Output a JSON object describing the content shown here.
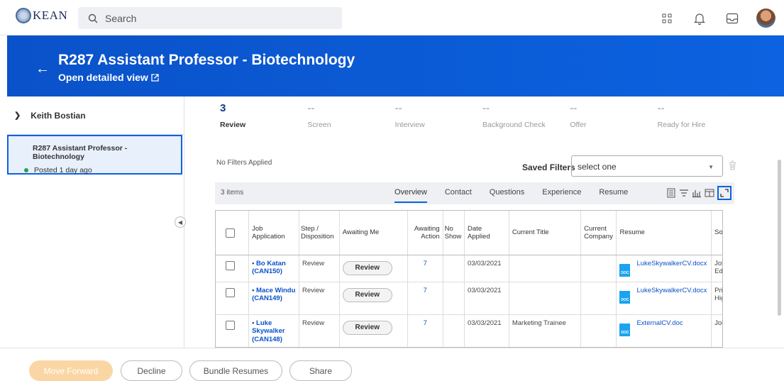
{
  "header": {
    "logo_text": "KEAN",
    "search_placeholder": "Search"
  },
  "banner": {
    "title": "R287 Assistant Professor - Biotechnology",
    "link": "Open detailed view"
  },
  "sidebar": {
    "person": "Keith Bostian",
    "job_title": "R287 Assistant Professor - Biotechnology",
    "job_status": "Posted 1 day ago"
  },
  "steps": [
    {
      "count": "3",
      "label": "Review"
    },
    {
      "count": "--",
      "label": "Screen"
    },
    {
      "count": "--",
      "label": "Interview"
    },
    {
      "count": "--",
      "label": "Background Check"
    },
    {
      "count": "--",
      "label": "Offer"
    },
    {
      "count": "--",
      "label": "Ready for Hire"
    }
  ],
  "filters": {
    "applied": "No Filters Applied",
    "saved_label": "Saved Filters",
    "saved_value": "select one"
  },
  "grid": {
    "items_count": "3 items",
    "tabs": [
      "Overview",
      "Contact",
      "Questions",
      "Experience",
      "Resume"
    ],
    "columns": [
      "Job Application",
      "Step / Disposition",
      "Awaiting Me",
      "Awaiting Action",
      "No Show",
      "Date Applied",
      "Current Title",
      "Current Company",
      "Resume",
      "Source"
    ],
    "rows": [
      {
        "candidate": "• Bo Katan (CAN150)",
        "step": "Review",
        "awaiting_me": "Review",
        "awaiting_action": "7",
        "no_show": "",
        "date": "03/03/2021",
        "title": "",
        "company": "",
        "resume": "LukeSkywalkerCV.docx",
        "source": "Job Site Educati"
      },
      {
        "candidate": "• Mace Windu (CAN149)",
        "step": "Review",
        "awaiting_me": "Review",
        "awaiting_action": "7",
        "no_show": "",
        "date": "03/03/2021",
        "title": "",
        "company": "",
        "resume": "LukeSkywalkerCV.docx",
        "source": "Print Pu Higher E"
      },
      {
        "candidate": "• Luke Skywalker (CAN148)",
        "step": "Review",
        "awaiting_me": "Review",
        "awaiting_action": "7",
        "no_show": "",
        "date": "03/03/2021",
        "title": "Marketing Trainee",
        "company": "",
        "resume": "ExternalCV.doc",
        "source": "Job Site"
      }
    ]
  },
  "footer": {
    "move_forward": "Move Forward",
    "decline": "Decline",
    "bundle": "Bundle Resumes",
    "share": "Share"
  },
  "colors": {
    "brand": "#0c62e0",
    "link": "#0a52c9",
    "posted": "#29a04a"
  }
}
